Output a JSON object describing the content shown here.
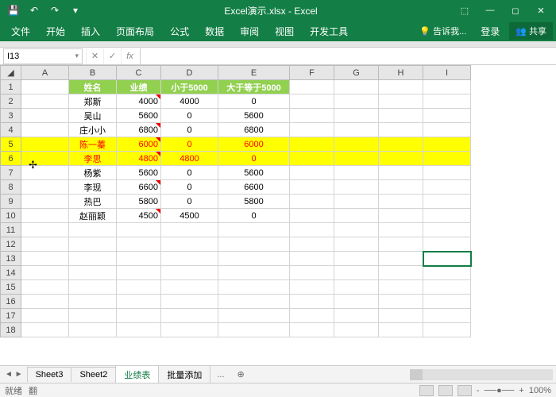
{
  "app": {
    "title": "Excel演示.xlsx - Excel"
  },
  "qat": {
    "save": "💾",
    "undo": "↶",
    "redo": "↷",
    "custom": "▾"
  },
  "win": {
    "ribbonopt": "⬚",
    "min": "—",
    "max": "◻",
    "close": "✕"
  },
  "ribbon": {
    "file": "文件",
    "home": "开始",
    "insert": "插入",
    "layout": "页面布局",
    "formula": "公式",
    "data": "数据",
    "review": "审阅",
    "view": "视图",
    "dev": "开发工具",
    "tell": "告诉我...",
    "login": "登录",
    "share": "共享"
  },
  "namebox": "I13",
  "cols": [
    "",
    "A",
    "B",
    "C",
    "D",
    "E",
    "F",
    "G",
    "H",
    "I"
  ],
  "hdr": {
    "b": "姓名",
    "c": "业绩",
    "d": "小于5000",
    "e": "大于等于5000"
  },
  "rows": [
    {
      "b": "郑斯",
      "c": "4000",
      "d": "4000",
      "e": "0"
    },
    {
      "b": "吴山",
      "c": "5600",
      "d": "0",
      "e": "5600"
    },
    {
      "b": "庄小小",
      "c": "6800",
      "d": "0",
      "e": "6800"
    },
    {
      "b": "陈一蓁",
      "c": "6000",
      "d": "0",
      "e": "6000",
      "hl": true
    },
    {
      "b": "李思",
      "c": "4800",
      "d": "4800",
      "e": "0",
      "hl": true
    },
    {
      "b": "杨紫",
      "c": "5600",
      "d": "0",
      "e": "5600"
    },
    {
      "b": "李现",
      "c": "6600",
      "d": "0",
      "e": "6600"
    },
    {
      "b": "热巴",
      "c": "5800",
      "d": "0",
      "e": "5800"
    },
    {
      "b": "赵丽颖",
      "c": "4500",
      "d": "4500",
      "e": "0"
    }
  ],
  "tabs": {
    "nav": "◄ ►",
    "s3": "Sheet3",
    "s2": "Sheet2",
    "active": "业绩表",
    "extra": "批量添加",
    "more": "...",
    "add": "⊕"
  },
  "status": {
    "ready": "就绪",
    "extra": "翻",
    "zoom": "100%",
    "plus": "+",
    "minus": "-"
  }
}
